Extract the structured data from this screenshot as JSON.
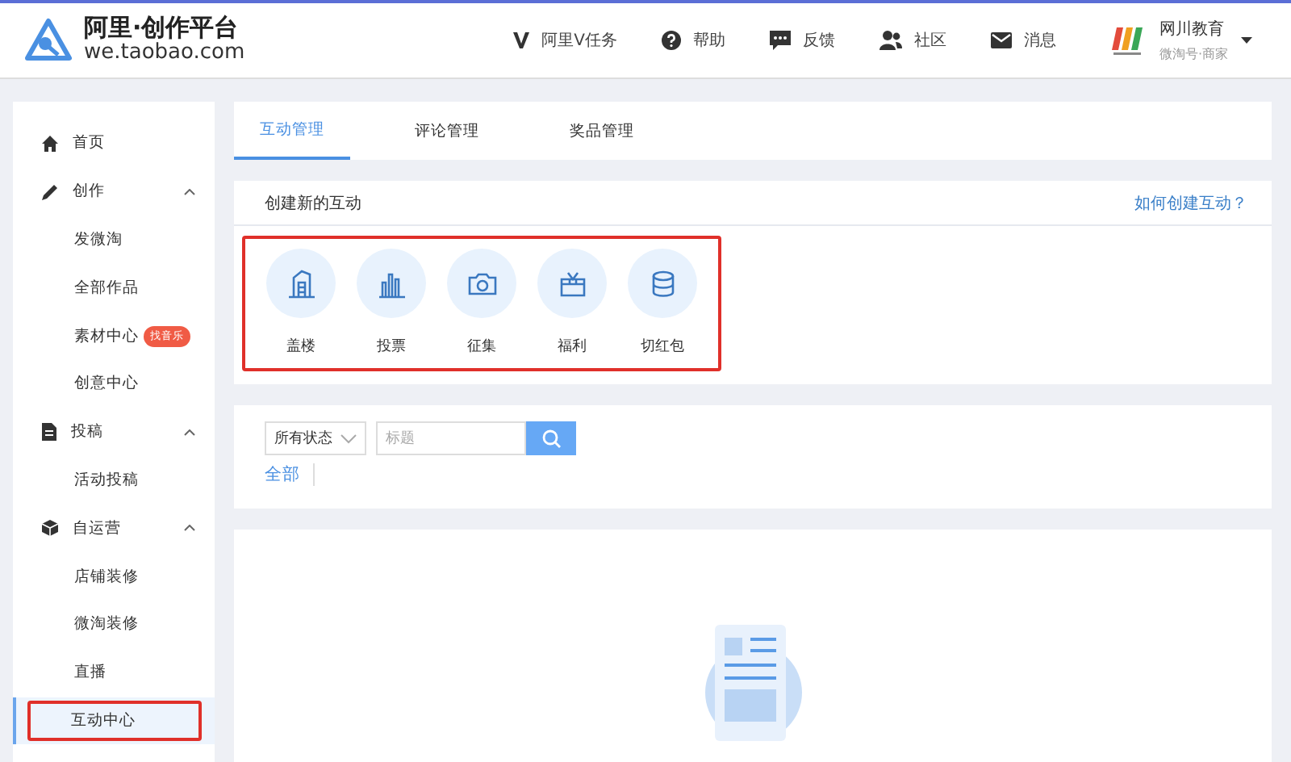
{
  "header": {
    "logo_title": "阿里·创作平台",
    "logo_url": "we.taobao.com",
    "nav": [
      {
        "kind": "v",
        "label": "阿里V任务"
      },
      {
        "kind": "help",
        "label": "帮助"
      },
      {
        "kind": "chat",
        "label": "反馈"
      },
      {
        "kind": "people",
        "label": "社区"
      },
      {
        "kind": "mail",
        "label": "消息"
      }
    ],
    "account": {
      "name": "网川教育",
      "role": "微淘号·商家"
    }
  },
  "sidebar": {
    "items": [
      {
        "kind": "home",
        "label": "首页"
      },
      {
        "kind": "pencil",
        "label": "创作",
        "expanded": true,
        "children": [
          {
            "label": "发微淘",
            "selected": false,
            "annotated": false
          },
          {
            "label": "全部作品",
            "selected": false,
            "annotated": false
          },
          {
            "label": "素材中心",
            "badge": "找音乐",
            "selected": false,
            "annotated": false
          },
          {
            "label": "创意中心",
            "selected": false,
            "annotated": false
          }
        ]
      },
      {
        "kind": "doc",
        "label": "投稿",
        "expanded": true,
        "children": [
          {
            "label": "活动投稿",
            "selected": false,
            "annotated": false
          }
        ]
      },
      {
        "kind": "box",
        "label": "自运营",
        "expanded": true,
        "children": [
          {
            "label": "店铺装修",
            "selected": false,
            "annotated": false
          },
          {
            "label": "微淘装修",
            "selected": false,
            "annotated": false
          },
          {
            "label": "直播",
            "selected": false,
            "annotated": false
          },
          {
            "label": "互动中心",
            "selected": true,
            "annotated": true
          }
        ]
      }
    ]
  },
  "tabs": [
    {
      "label": "互动管理",
      "selected": true
    },
    {
      "label": "评论管理",
      "selected": false
    },
    {
      "label": "奖品管理",
      "selected": false
    }
  ],
  "create": {
    "title": "创建新的互动",
    "help_link": "如何创建互动？",
    "annotated": true,
    "types": [
      {
        "kind": "building",
        "label": "盖楼"
      },
      {
        "kind": "bars",
        "label": "投票"
      },
      {
        "kind": "camera",
        "label": "征集"
      },
      {
        "kind": "gift",
        "label": "福利"
      },
      {
        "kind": "coins",
        "label": "切红包"
      }
    ]
  },
  "filter": {
    "status": "所有状态",
    "search_placeholder": "标题",
    "categories": [
      {
        "label": "全部",
        "selected": true
      }
    ]
  }
}
